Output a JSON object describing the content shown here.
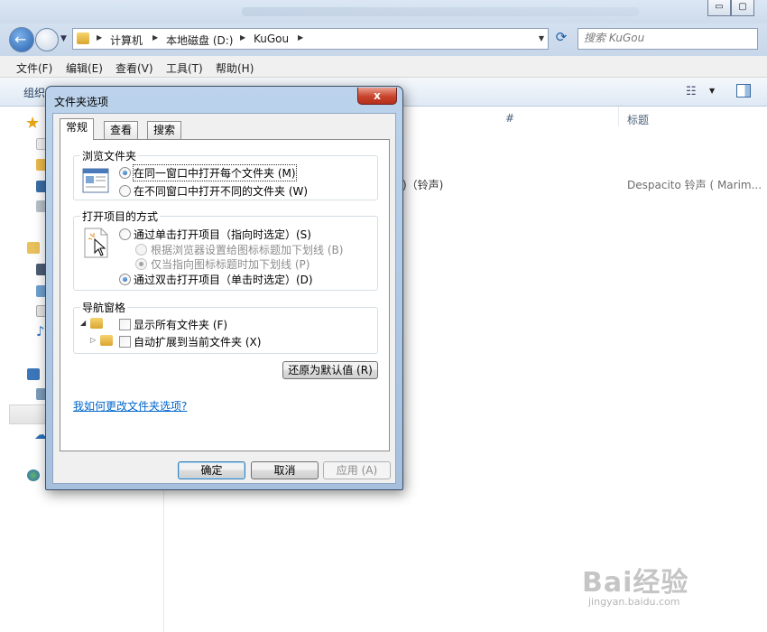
{
  "explorer": {
    "window_buttons": {
      "minimize": "▭",
      "maximize": "▢"
    },
    "breadcrumbs": [
      "计算机",
      "本地磁盘 (D:)",
      "KuGou"
    ],
    "search_placeholder": "搜索 KuGou",
    "menu": [
      "文件(F)",
      "编辑(E)",
      "查看(V)",
      "工具(T)",
      "帮助(H)"
    ],
    "toolbar": {
      "organize": "组织"
    },
    "columns": {
      "number": "#",
      "title": "标题"
    },
    "row": {
      "name_tail": ")（铃声)",
      "title": "Despacito 铃声 ( Marim..."
    }
  },
  "dialog": {
    "title": "文件夹选项",
    "close_label": "x",
    "tabs": [
      {
        "label": "常规",
        "active": true
      },
      {
        "label": "查看",
        "active": false
      },
      {
        "label": "搜索",
        "active": false
      }
    ],
    "browse_group": {
      "title": "浏览文件夹",
      "options": [
        {
          "label": "在同一窗口中打开每个文件夹 (M)",
          "checked": true
        },
        {
          "label": "在不同窗口中打开不同的文件夹 (W)",
          "checked": false
        }
      ]
    },
    "click_group": {
      "title": "打开项目的方式",
      "options": [
        {
          "label": "通过单击打开项目（指向时选定）(S)",
          "checked": false,
          "disabled": false
        },
        {
          "label": "根据浏览器设置给图标标题加下划线 (B)",
          "checked": false,
          "disabled": true
        },
        {
          "label": "仅当指向图标标题时加下划线 (P)",
          "checked": true,
          "disabled": true
        },
        {
          "label": "通过双击打开项目（单击时选定）(D)",
          "checked": true,
          "disabled": false
        }
      ]
    },
    "nav_group": {
      "title": "导航窗格",
      "options": [
        {
          "label": "显示所有文件夹 (F)",
          "checked": false
        },
        {
          "label": "自动扩展到当前文件夹 (X)",
          "checked": false
        }
      ]
    },
    "restore_button": "还原为默认值 (R)",
    "help_link": "我如何更改文件夹选项?",
    "ok_button": "确定",
    "cancel_button": "取消",
    "apply_button": "应用 (A)"
  },
  "watermark": {
    "brand": "Bai经验",
    "url": "jingyan.baidu.com"
  }
}
